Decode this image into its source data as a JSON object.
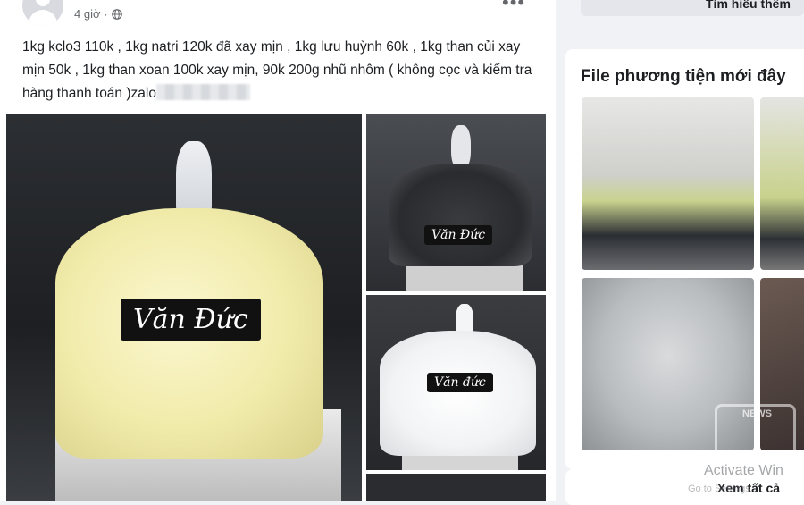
{
  "post": {
    "time": "4 giờ",
    "separator": "·",
    "text": "1kg kclo3 110k , 1kg natri 120k đã xay mịn ,  1kg lưu huỳnh 60k ,  1kg than củi xay mịn 50k , 1kg than xoan 100k xay mịn, 90k 200g nhũ nhôm ( không cọc và kiểm tra hàng thanh toán )zalo",
    "photos": [
      {
        "watermark": "Văn Đức"
      },
      {
        "watermark": "Văn Đức"
      },
      {
        "watermark": "Văn đức"
      }
    ],
    "icons": {
      "globe": "globe-icon",
      "more": "more-options-icon"
    }
  },
  "sidebar": {
    "top_button_label": "Tìm hiểu thêm",
    "media": {
      "title": "File phương tiện mới đây",
      "see_all_label": "Xem tất cả"
    }
  },
  "overlay": {
    "activate_line1": "Activate Win",
    "activate_line2": "Go to Settings",
    "logo_text": "NEWS"
  }
}
